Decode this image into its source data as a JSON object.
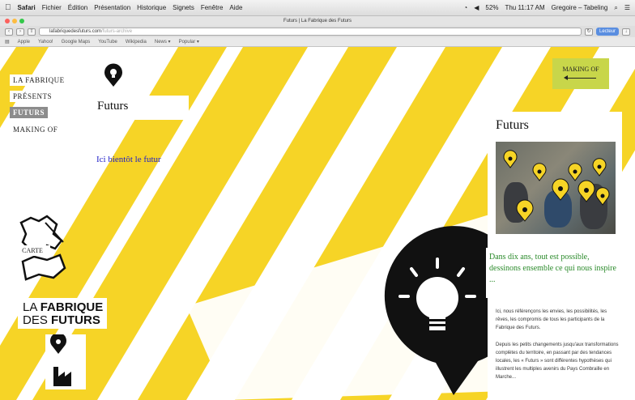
{
  "menubar": {
    "app": "Safari",
    "items": [
      "Fichier",
      "Édition",
      "Présentation",
      "Historique",
      "Signets",
      "Fenêtre",
      "Aide"
    ],
    "clock": "Thu 11:17 AM",
    "user": "Gregoire – Tabeling",
    "battery": "52%"
  },
  "window": {
    "title": "Futurs | La Fabrique des Futurs"
  },
  "toolbar": {
    "url": "lafabriquedesfuturs.com",
    "url_suffix": "/futurs-archive",
    "search_label": "Lecteur"
  },
  "bookmarks": [
    "Apple",
    "Yahoo!",
    "Google Maps",
    "YouTube",
    "Wikipedia",
    "News ▾",
    "Popular ▾"
  ],
  "nav": {
    "items": [
      "LA FABRIQUE",
      "PRÉSENTS",
      "FUTURS",
      "MAKING OF"
    ],
    "active": "FUTURS"
  },
  "main": {
    "title": "Futurs",
    "content": "Ici bientôt le futur"
  },
  "making_of": {
    "label": "MAKING OF"
  },
  "map": {
    "label": "CARTE"
  },
  "logo": {
    "line1_a": "LA ",
    "line1_b": "FABRIQUE",
    "line2_a": "DES ",
    "line2_b": "FUTURS"
  },
  "side": {
    "title": "Futurs",
    "quote": "Dans dix ans, tout est possible, dessinons ensemble ce qui nous inspire ...",
    "para1": "Ici, nous référençons les envies, les possibilités, les rêves, les compromis de tous les participants de la Fabrique des Futurs.",
    "para2": "Depuis les petits changements jusqu'aux transformations complètes du territoire, en passant par des tendances locales, les « Futurs » sont différentes hypothèses qui illustrent les multiples avenirs du Pays Combraille en Marche..."
  },
  "colors": {
    "stripe": "#f6d426",
    "accent_green": "#c8d64a",
    "quote_green": "#2a8a2a",
    "link_blue": "#1f1fc7"
  }
}
